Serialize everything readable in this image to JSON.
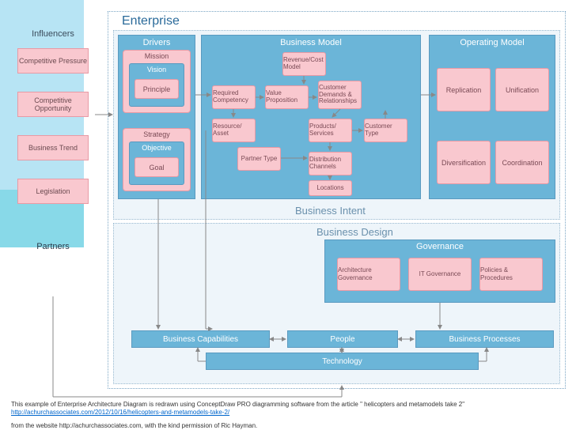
{
  "enterprise": {
    "title": "Enterprise"
  },
  "influencers": {
    "title": "Influencers",
    "items": [
      "Competitive Pressure",
      "Competitive Opportunity",
      "Business Trend",
      "Legislation"
    ]
  },
  "partners": {
    "title": "Partners"
  },
  "business_intent": {
    "label": "Business Intent"
  },
  "business_design": {
    "label": "Business Design"
  },
  "drivers": {
    "title": "Drivers",
    "mission": "Mission",
    "vision": "Vision",
    "principle": "Principle",
    "strategy": "Strategy",
    "objective": "Objective",
    "goal": "Goal"
  },
  "business_model": {
    "title": "Business Model",
    "revenue_cost": "Revenue/Cost Model",
    "required_competency": "Required Competency",
    "value_proposition": "Value Proposition",
    "customer_demands": "Customer Demands & Relationships",
    "resource_asset": "Resource/ Asset",
    "products_services": "Products/ Services",
    "customer_type": "Customer Type",
    "partner_type": "Partner Type",
    "distribution_channels": "Distribution Channels",
    "locations": "Locations"
  },
  "operating_model": {
    "title": "Operating Model",
    "replication": "Replication",
    "unification": "Unification",
    "diversification": "Diversification",
    "coordination": "Coordination"
  },
  "governance": {
    "title": "Governance",
    "arch": "Architecture Governance",
    "it": "IT Governance",
    "policies": "Policies & Procedures"
  },
  "bars": {
    "capabilities": "Business Capabilities",
    "people": "People",
    "processes": "Business Processes",
    "technology": "Technology"
  },
  "footer": {
    "line1": "This example of Enterprise Architecture Diagram is redrawn using ConceptDraw PRO diagramming software from the article \" helicopters and metamodels take 2\"",
    "link": "http://achurchassociates.com/2012/10/16/helicopters-and-metamodels-take-2/",
    "line2": "from the website http://achurchassociates.com, with the kind permission of Ric Hayman."
  }
}
